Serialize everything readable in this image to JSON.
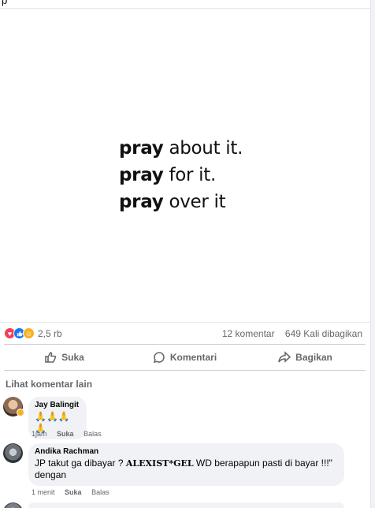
{
  "top_crop_text": "p",
  "post": {
    "quote_lines": [
      {
        "bold": "pray",
        "rest": "about it."
      },
      {
        "bold": "pray",
        "rest": "for it."
      },
      {
        "bold": "pray",
        "rest": "over it"
      }
    ]
  },
  "stats": {
    "reaction_icons": [
      "love",
      "like",
      "care"
    ],
    "reaction_count": "2,5 rb",
    "comments": "12 komentar",
    "shares": "649 Kali dibagikan"
  },
  "actions": {
    "like_label": "Suka",
    "comment_label": "Komentari",
    "share_label": "Bagikan"
  },
  "comments_section": {
    "more_label": "Lihat komentar lain",
    "items": [
      {
        "name": "Jay Balingit",
        "text": "🙏🙏🙏🙏",
        "time": "1jam",
        "like": "Suka",
        "reply": "Balas"
      },
      {
        "name": "Andika Rachman",
        "text_pre": "JP takut ga dibayar ? ",
        "text_strong": "ALEXIST*GEL",
        "text_post": " WD berapapun pasti di bayar !!!\" dengan",
        "time": "1 menit",
        "like": "Suka",
        "reply": "Balas"
      }
    ]
  }
}
